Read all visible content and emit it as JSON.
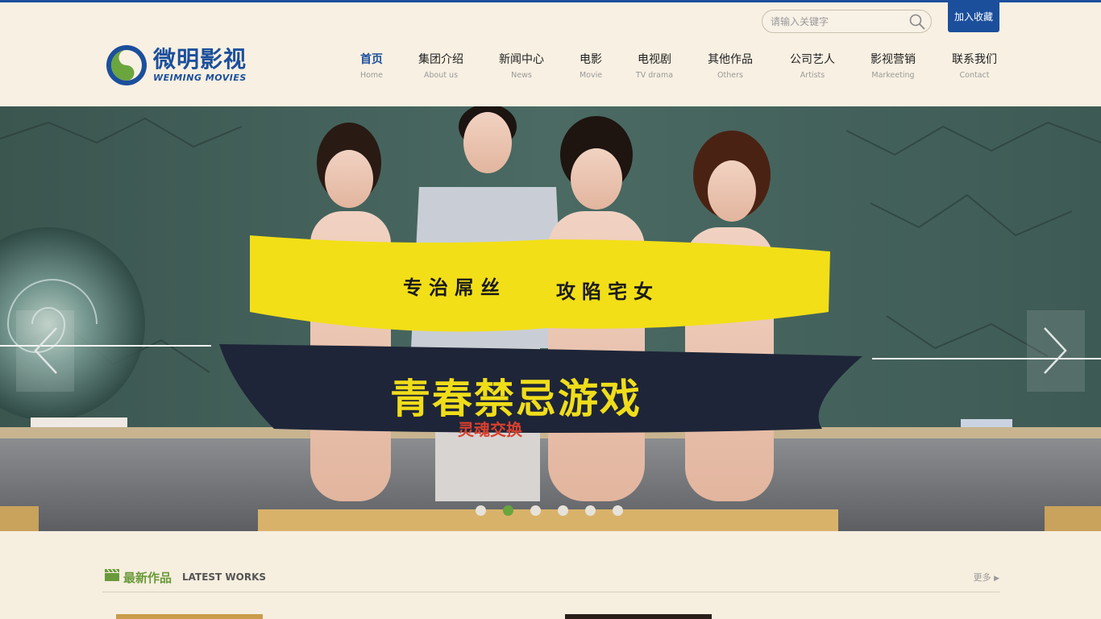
{
  "header": {
    "logo": {
      "cn": "微明影视",
      "en": "WEIMING MOVIES",
      "icon": "swirl-logo-icon"
    },
    "search": {
      "placeholder": "请输入关键字",
      "icon": "search-icon"
    },
    "favorite_label": "加入收藏"
  },
  "nav": {
    "items": [
      {
        "cn": "首页",
        "en": "Home"
      },
      {
        "cn": "集团介绍",
        "en": "About us"
      },
      {
        "cn": "新闻中心",
        "en": "News"
      },
      {
        "cn": "电影",
        "en": "Movie"
      },
      {
        "cn": "电视剧",
        "en": "TV drama"
      },
      {
        "cn": "其他作品",
        "en": "Others"
      },
      {
        "cn": "公司艺人",
        "en": "Artists"
      },
      {
        "cn": "影视营销",
        "en": "Markeeting"
      },
      {
        "cn": "联系我们",
        "en": "Contact"
      }
    ],
    "active": "首页"
  },
  "banner": {
    "slogan_left": "专治屌丝",
    "slogan_right": "攻陷宅女",
    "movie_title": "青春禁忌游戏",
    "movie_subtitle": "灵魂交换",
    "slides_count": 6,
    "active_slide": 2,
    "prev_icon": "chevron-left-icon",
    "next_icon": "chevron-right-icon"
  },
  "latest": {
    "title": "最新作品",
    "subtitle": "LATEST WORKS",
    "more_label": "更多",
    "icon": "clapperboard-icon"
  },
  "colors": {
    "brand_blue": "#1b4f9c",
    "accent_green": "#6aa53e",
    "background": "#f6eedf"
  }
}
